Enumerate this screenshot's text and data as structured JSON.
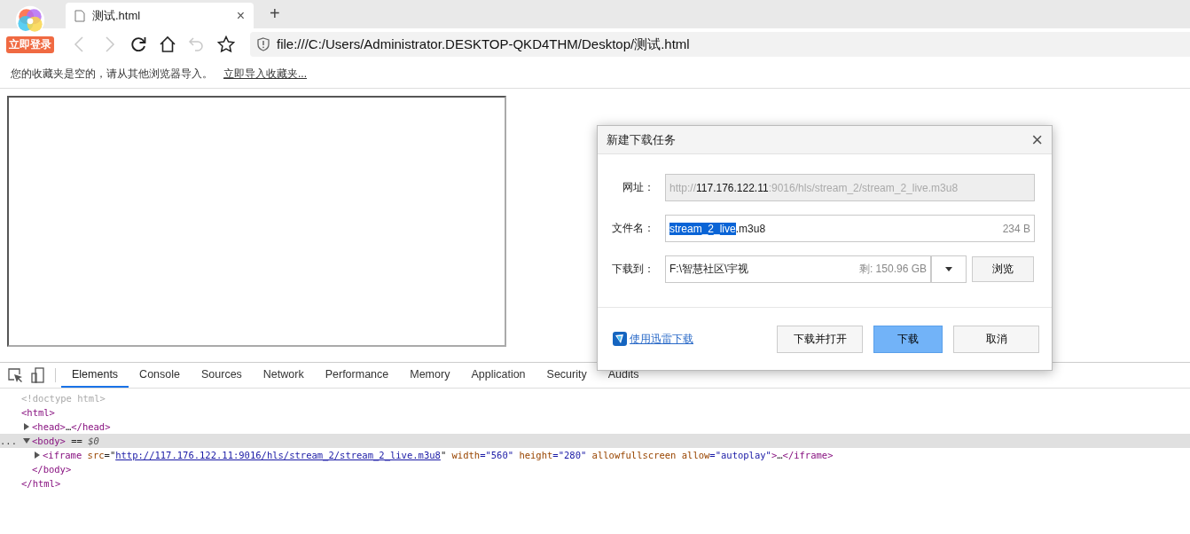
{
  "browser": {
    "login_badge": "立即登录",
    "tabs": [
      {
        "title": "测试.html",
        "selected": true,
        "close": "×"
      }
    ],
    "new_tab": "+",
    "nav": [
      {
        "kind": "back",
        "disabled": true
      },
      {
        "kind": "forward",
        "disabled": true
      },
      {
        "kind": "reload",
        "disabled": false
      },
      {
        "kind": "home",
        "disabled": false
      },
      {
        "kind": "undo",
        "disabled": true
      },
      {
        "kind": "star",
        "disabled": false
      }
    ],
    "address": "file:///C:/Users/Administrator.DESKTOP-QKD4THM/Desktop/测试.html"
  },
  "bookmarks_bar": {
    "message": "您的收藏夹是空的，请从其他浏览器导入。",
    "import_link": "立即导入收藏夹..."
  },
  "devtools": {
    "tabs": [
      {
        "label": "Elements",
        "selected": true
      },
      {
        "label": "Console",
        "selected": false
      },
      {
        "label": "Sources",
        "selected": false
      },
      {
        "label": "Network",
        "selected": false
      },
      {
        "label": "Performance",
        "selected": false
      },
      {
        "label": "Memory",
        "selected": false
      },
      {
        "label": "Application",
        "selected": false
      },
      {
        "label": "Security",
        "selected": false
      },
      {
        "label": "Audits",
        "selected": false
      }
    ],
    "tree": [
      {
        "segments": [
          {
            "kind": "doctype",
            "text": "<!doctype html>"
          }
        ]
      },
      {
        "segments": [
          {
            "kind": "tag",
            "text": "<html>"
          }
        ],
        "close": [
          {
            "kind": "tag",
            "text": "</html>"
          }
        ],
        "children": [
          {
            "expanded": false,
            "selected": false,
            "segments": [
              {
                "kind": "tag",
                "text": "<head>"
              },
              {
                "kind": "text",
                "text": "…"
              },
              {
                "kind": "tag",
                "text": "</head>"
              }
            ]
          },
          {
            "expanded": true,
            "selected": true,
            "gutter": "...",
            "segments": [
              {
                "kind": "tag",
                "text": "<body>"
              },
              {
                "kind": "text",
                "text": " == "
              },
              {
                "kind": "var",
                "text": "$0"
              }
            ],
            "close": [
              {
                "kind": "tag",
                "text": "</body>"
              }
            ],
            "children": [
              {
                "expanded": false,
                "selected": false,
                "segments": [
                  {
                    "kind": "tag",
                    "text": "<iframe"
                  },
                  {
                    "kind": "attr",
                    "text": " src"
                  },
                  {
                    "kind": "text",
                    "text": "=\""
                  },
                  {
                    "kind": "link",
                    "text": "http://117.176.122.11:9016/hls/stream_2/stream_2_live.m3u8"
                  },
                  {
                    "kind": "text",
                    "text": "\""
                  },
                  {
                    "kind": "attr",
                    "text": " width"
                  },
                  {
                    "kind": "value",
                    "text": "=\"560\""
                  },
                  {
                    "kind": "attr",
                    "text": " height"
                  },
                  {
                    "kind": "value",
                    "text": "=\"280\""
                  },
                  {
                    "kind": "attr",
                    "text": " allowfullscreen allow"
                  },
                  {
                    "kind": "value",
                    "text": "=\"autoplay\""
                  },
                  {
                    "kind": "tag",
                    "text": ">"
                  },
                  {
                    "kind": "text",
                    "text": "…"
                  },
                  {
                    "kind": "tag",
                    "text": "</iframe>"
                  }
                ]
              }
            ]
          }
        ]
      }
    ]
  },
  "dialog": {
    "title": "新建下载任务",
    "close": "×",
    "url": {
      "label": "网址：",
      "disabled": true,
      "segments": [
        {
          "text": "http://",
          "strong": false
        },
        {
          "text": "117.176.122.11",
          "strong": true
        },
        {
          "text": ":9016/hls/stream_2/stream_2_live.m3u8",
          "strong": false
        }
      ]
    },
    "filename": {
      "label": "文件名：",
      "selected_text": "stream_2_live",
      "rest": ".m3u8",
      "size": "234 B"
    },
    "save_to": {
      "label": "下载到：",
      "path": "F:\\智慧社区\\宇视",
      "free": "剩: 150.96 GB",
      "browse": "浏览"
    },
    "thunder_link": "使用迅雷下载",
    "buttons": [
      {
        "label": "下载并打开",
        "kind": "default"
      },
      {
        "label": "下载",
        "kind": "primary"
      },
      {
        "label": "取消",
        "kind": "default"
      }
    ]
  }
}
